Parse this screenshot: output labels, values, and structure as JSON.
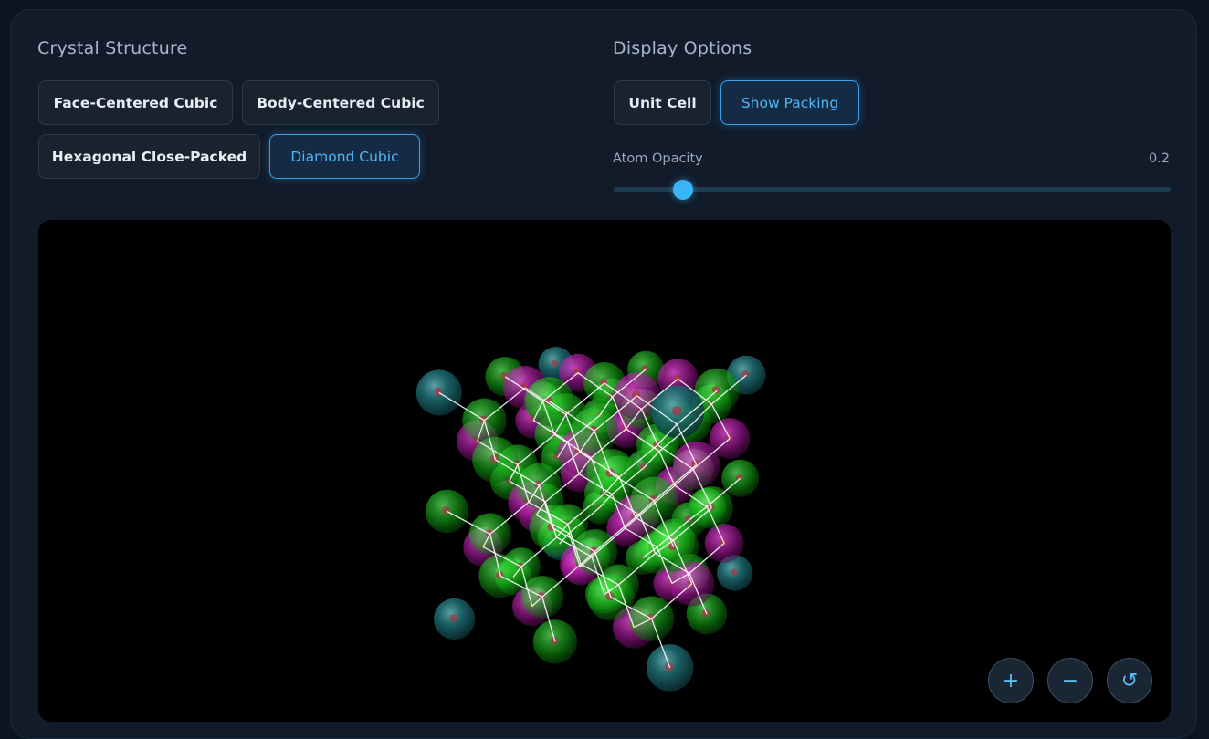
{
  "crystal_structure": {
    "title": "Crystal Structure",
    "buttons": [
      {
        "label": "Face-Centered Cubic",
        "active": false
      },
      {
        "label": "Body-Centered Cubic",
        "active": false
      },
      {
        "label": "Hexagonal Close-Packed",
        "active": false
      },
      {
        "label": "Diamond Cubic",
        "active": true
      }
    ]
  },
  "display_options": {
    "title": "Display Options",
    "buttons": [
      {
        "label": "Unit Cell",
        "active": false
      },
      {
        "label": "Show Packing",
        "active": true
      }
    ],
    "opacity": {
      "label": "Atom Opacity",
      "value_text": "0.2",
      "value": 0.2
    }
  },
  "view_controls": {
    "zoom_in": "+",
    "zoom_out": "−",
    "reset": "↺"
  },
  "colors": {
    "accent": "#39b5f5",
    "atom_teal": "#1f6d73",
    "atom_green": "#22cc22",
    "atom_magenta": "#c01fb0",
    "bond": "#ffffff"
  }
}
